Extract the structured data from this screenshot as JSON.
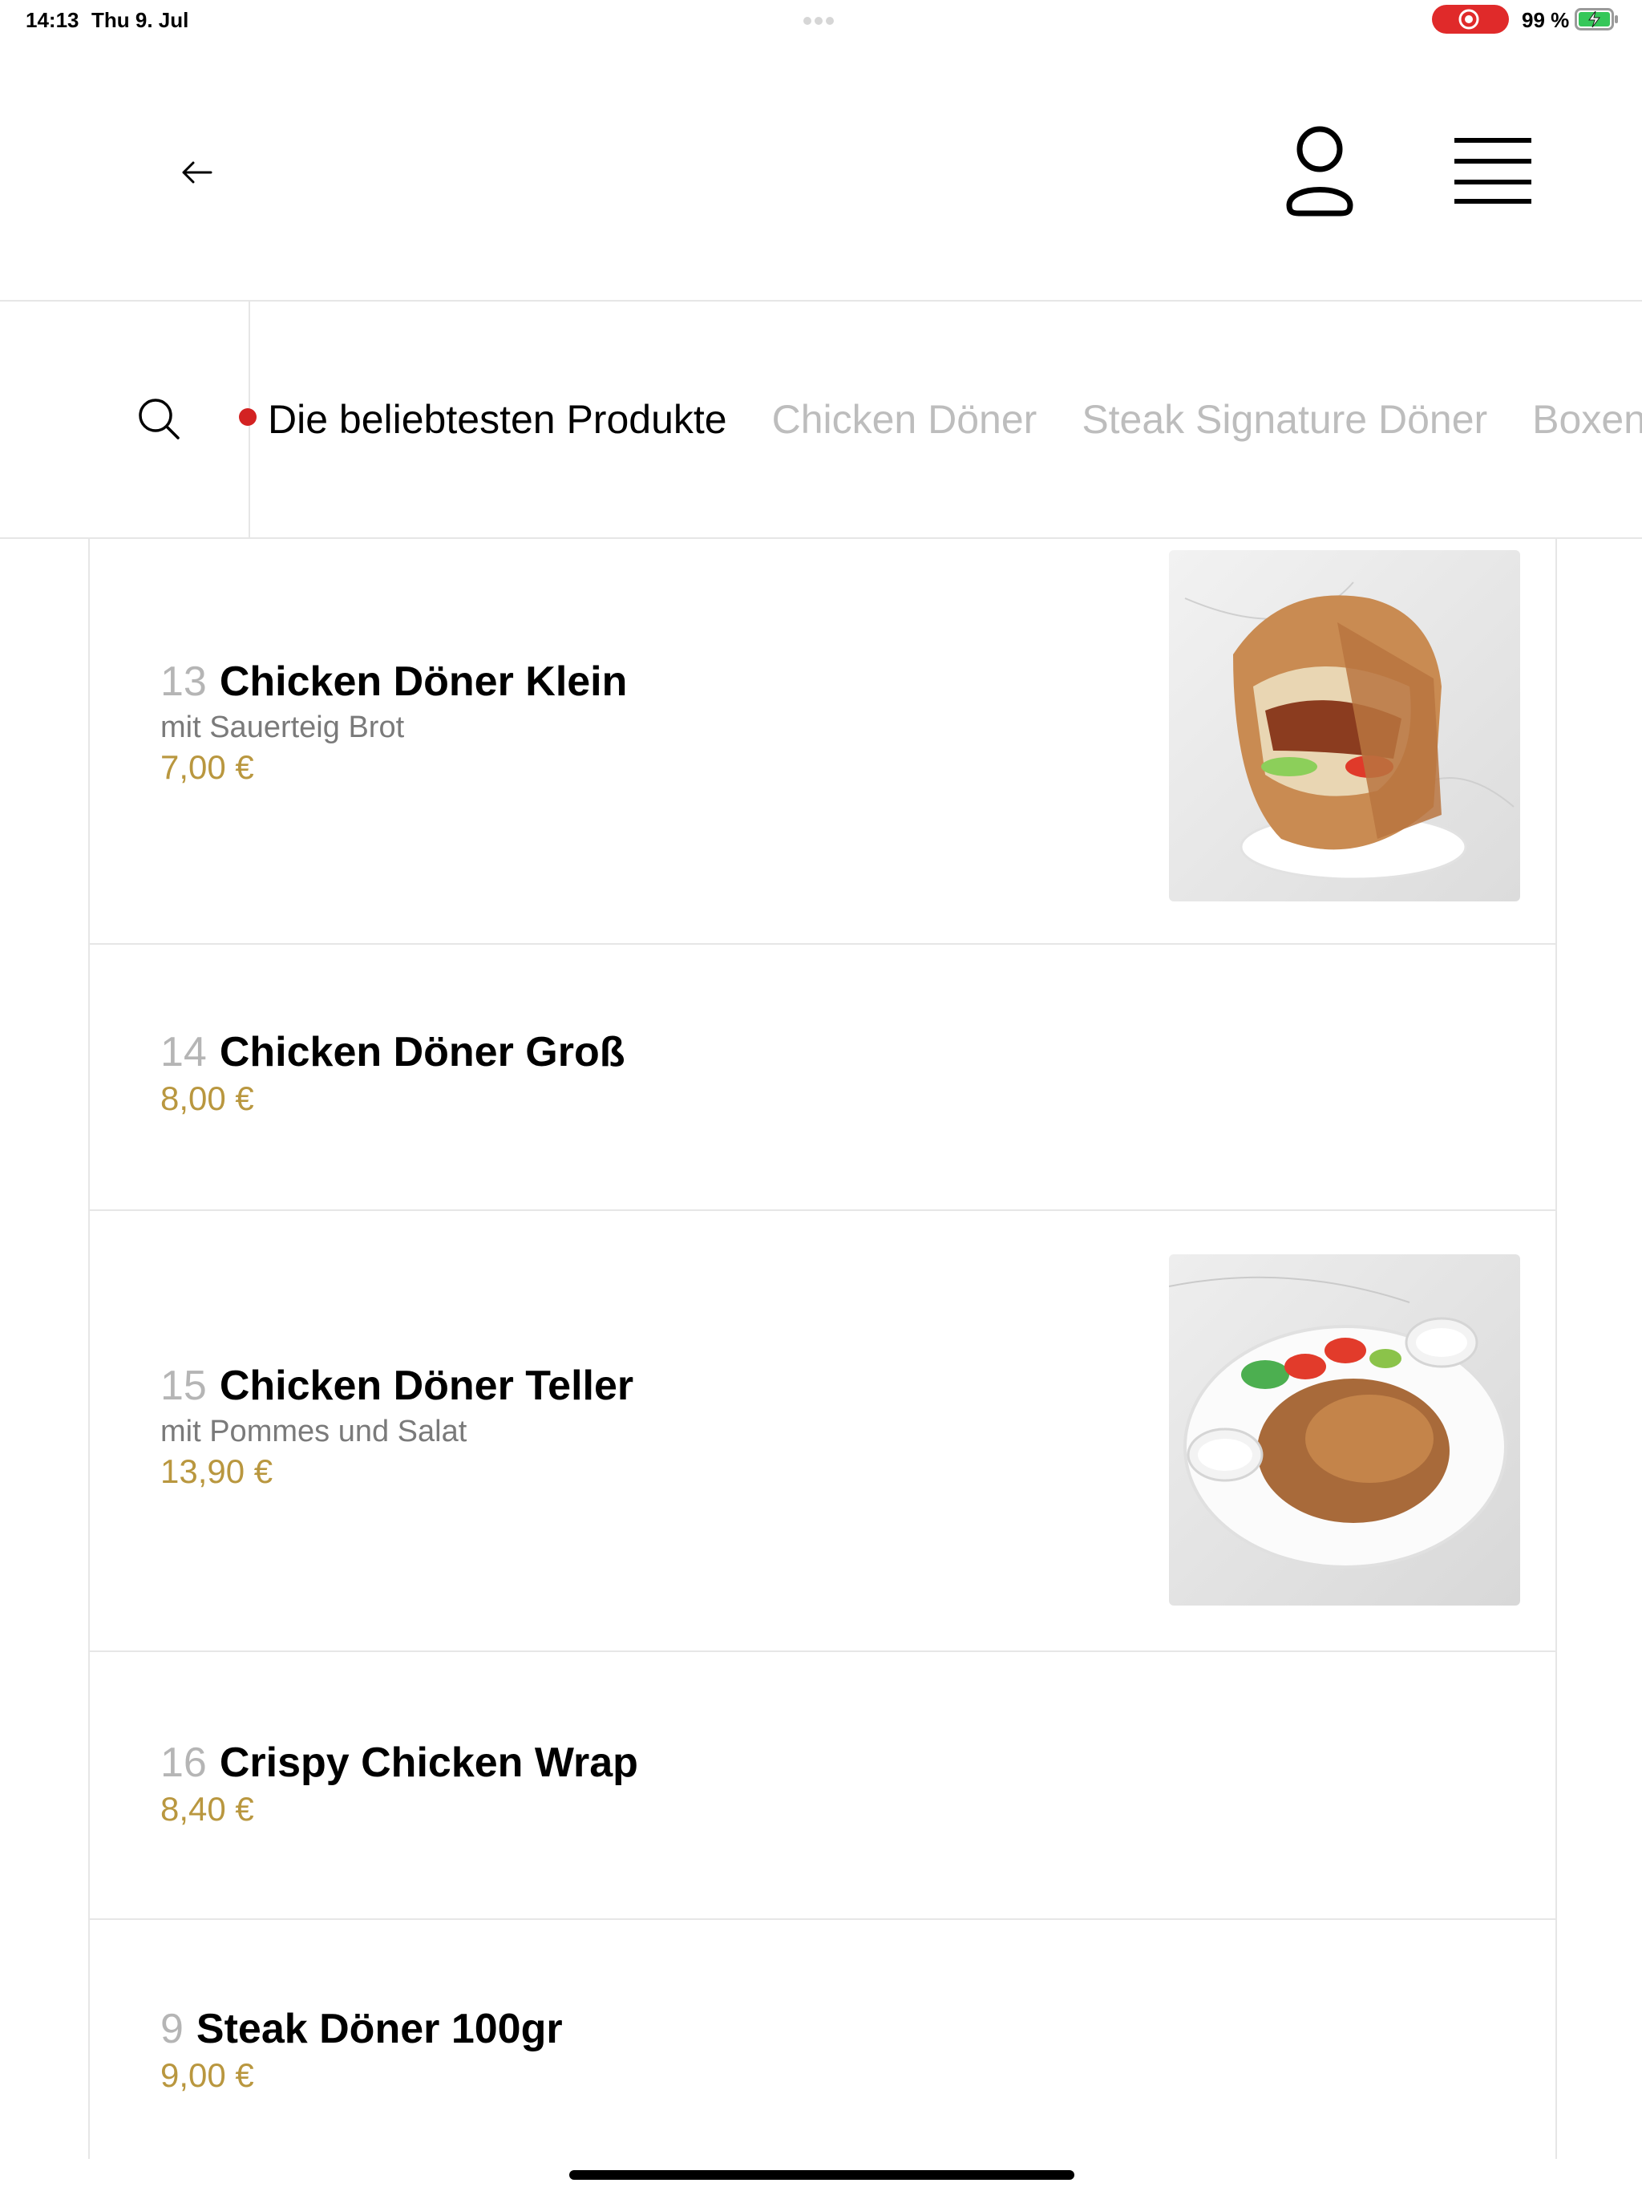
{
  "status_bar": {
    "time": "14:13",
    "date": "Thu 9. Jul",
    "battery": "99 %"
  },
  "icons": {
    "back": "arrow-left-icon",
    "user": "user-icon",
    "menu": "hamburger-menu-icon",
    "search": "search-icon"
  },
  "colors": {
    "price": "#b9973f",
    "active_tab": "#000000",
    "inactive_tab": "#bdbdbd",
    "accent_red": "#d32222",
    "divider": "#e6e6e6"
  },
  "category_tabs": [
    {
      "label": "Die beliebtesten Produkte",
      "active": true
    },
    {
      "label": "Chicken Döner",
      "active": false
    },
    {
      "label": "Steak Signature Döner",
      "active": false
    },
    {
      "label": "Boxen",
      "active": false
    }
  ],
  "products": [
    {
      "number": "13",
      "name": "Chicken Döner Klein",
      "description": "mit Sauerteig Brot",
      "price": "7,00 €",
      "image": "doner-sandwich-photo"
    },
    {
      "number": "14",
      "name": "Chicken Döner Groß",
      "description": "",
      "price": "8,00 €",
      "image": ""
    },
    {
      "number": "15",
      "name": "Chicken Döner Teller",
      "description": "mit Pommes und Salat",
      "price": "13,90 €",
      "image": "doner-plate-photo"
    },
    {
      "number": "16",
      "name": "Crispy Chicken Wrap",
      "description": "",
      "price": "8,40 €",
      "image": ""
    },
    {
      "number": "9",
      "name": "Steak Döner 100gr",
      "description": "",
      "price": "9,00 €",
      "image": ""
    }
  ]
}
